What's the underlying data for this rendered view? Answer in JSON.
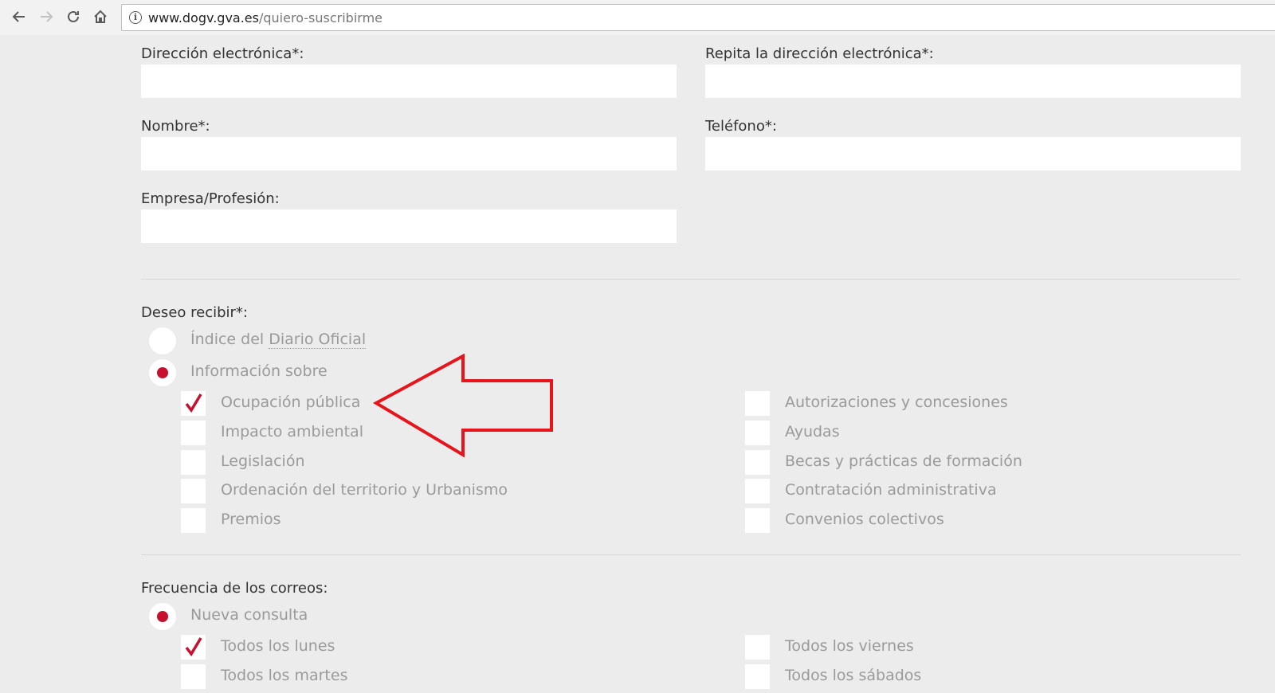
{
  "browser": {
    "url_host": "www.dogv.gva.es",
    "url_path": "/quiero-suscribirme"
  },
  "form": {
    "email_label": "Dirección electrónica*:",
    "email_repeat_label": "Repita la dirección electrónica*:",
    "name_label": "Nombre*:",
    "phone_label": "Teléfono*:",
    "company_label": "Empresa/Profesión:",
    "receive_label": "Deseo recibir*:",
    "receive_options": {
      "index_prefix": "Índice del ",
      "index_link": "Diario Oficial",
      "index_selected": false,
      "info": "Información sobre",
      "info_selected": true
    },
    "topics_left": [
      {
        "label": "Ocupación pública",
        "checked": true
      },
      {
        "label": "Impacto ambiental",
        "checked": false
      },
      {
        "label": "Legislación",
        "checked": false
      },
      {
        "label": "Ordenación del territorio y Urbanismo",
        "checked": false
      },
      {
        "label": "Premios",
        "checked": false
      }
    ],
    "topics_right": [
      {
        "label": "Autorizaciones y concesiones",
        "checked": false
      },
      {
        "label": "Ayudas",
        "checked": false
      },
      {
        "label": "Becas y prácticas de formación",
        "checked": false
      },
      {
        "label": "Contratación administrativa",
        "checked": false
      },
      {
        "label": "Convenios colectivos",
        "checked": false
      }
    ],
    "frequency_label": "Frecuencia de los correos:",
    "frequency_option": "Nueva consulta",
    "frequency_selected": true,
    "days_left": [
      {
        "label": "Todos los lunes",
        "checked": true
      },
      {
        "label": "Todos los martes",
        "checked": false
      }
    ],
    "days_right": [
      {
        "label": "Todos los viernes",
        "checked": false
      },
      {
        "label": "Todos los sábados",
        "checked": false
      }
    ]
  },
  "colors": {
    "accent": "#c8102e",
    "annotation_arrow": "#e8141b",
    "page_background": "#ececec"
  },
  "icons": {
    "back": "arrow-left-icon",
    "forward": "arrow-right-icon",
    "reload": "reload-icon",
    "home": "home-icon",
    "info": "info-icon",
    "check": "checkmark-icon"
  }
}
